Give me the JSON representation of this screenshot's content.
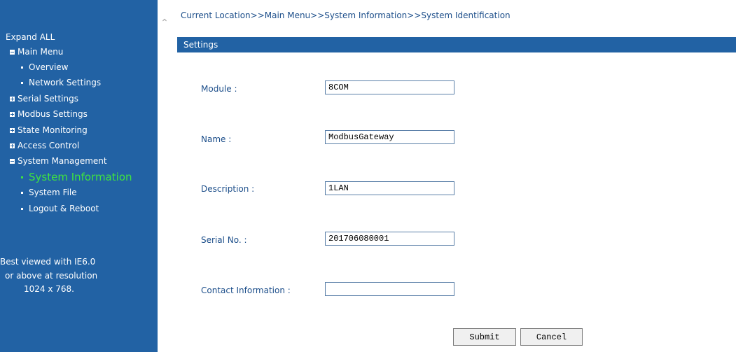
{
  "breadcrumb": "Current Location>>Main Menu>>System Information>>System Identification",
  "sidebar": {
    "expand_all": "Expand ALL",
    "main_menu": "Main Menu",
    "items": {
      "overview": "Overview",
      "network_settings": "Network Settings",
      "serial_settings": "Serial Settings",
      "modbus_settings": "Modbus Settings",
      "state_monitoring": "State Monitoring",
      "access_control": "Access Control",
      "system_management": "System Management",
      "system_information": "System Information",
      "system_file": "System File",
      "logout_reboot": "Logout & Reboot"
    },
    "note": [
      "Best viewed with IE6.0",
      "or above at resolution",
      "1024 x 768."
    ]
  },
  "settings": {
    "title": "Settings",
    "fields": {
      "module": {
        "label": "Module :",
        "value": "8COM"
      },
      "name": {
        "label": "Name :",
        "value": "ModbusGateway"
      },
      "description": {
        "label": "Description :",
        "value": "1LAN"
      },
      "serial_no": {
        "label": "Serial No. :",
        "value": "201706080001"
      },
      "contact": {
        "label": "Contact Information :",
        "value": ""
      }
    },
    "submit_label": "Submit",
    "cancel_label": "Cancel"
  },
  "colors": {
    "sidebar_bg": "#2262a4",
    "active_item": "#3fe43f",
    "label_text": "#1c4e8a"
  },
  "icons": {
    "collapse": "chevron-up-icon",
    "expanded": "minus-box-icon",
    "collapsed": "plus-box-icon"
  }
}
